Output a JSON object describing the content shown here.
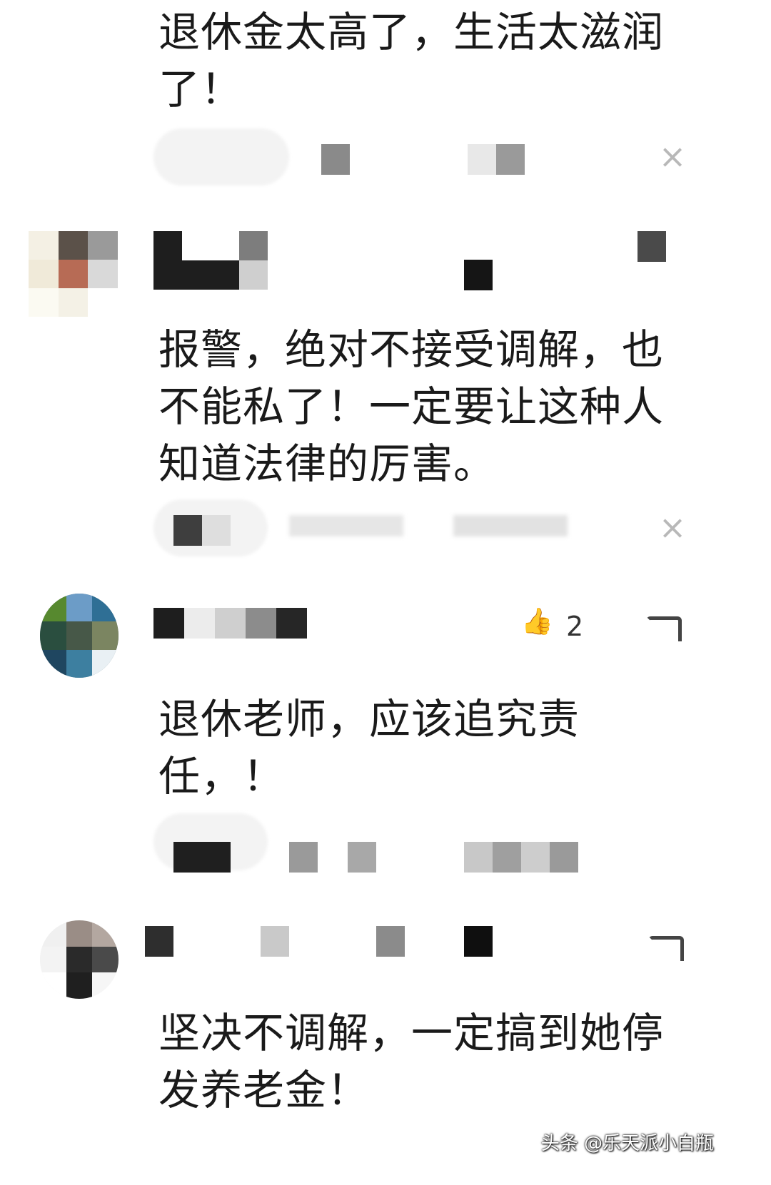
{
  "comments": [
    {
      "text_lines": [
        "退休金太高了，生活太滋润",
        "了！"
      ]
    },
    {
      "text_lines": [
        "报警，绝对不接受调解，也",
        "不能私了！一定要让这种人",
        "知道法律的厉害。"
      ]
    },
    {
      "text_lines": [
        "退休老师，应该追究责",
        "任，！"
      ],
      "like_count": "2"
    },
    {
      "text_lines": [
        "坚决不调解，一定搞到她停",
        "发养老金！"
      ]
    }
  ],
  "icons": {
    "close": "close-icon",
    "like": "thumbs-up-icon",
    "reply": "reply-icon"
  },
  "watermark": "头条 @乐天派小白瓶",
  "colors": {
    "text": "#1a1a1a",
    "muted": "#b8b8b8",
    "background": "#ffffff"
  }
}
